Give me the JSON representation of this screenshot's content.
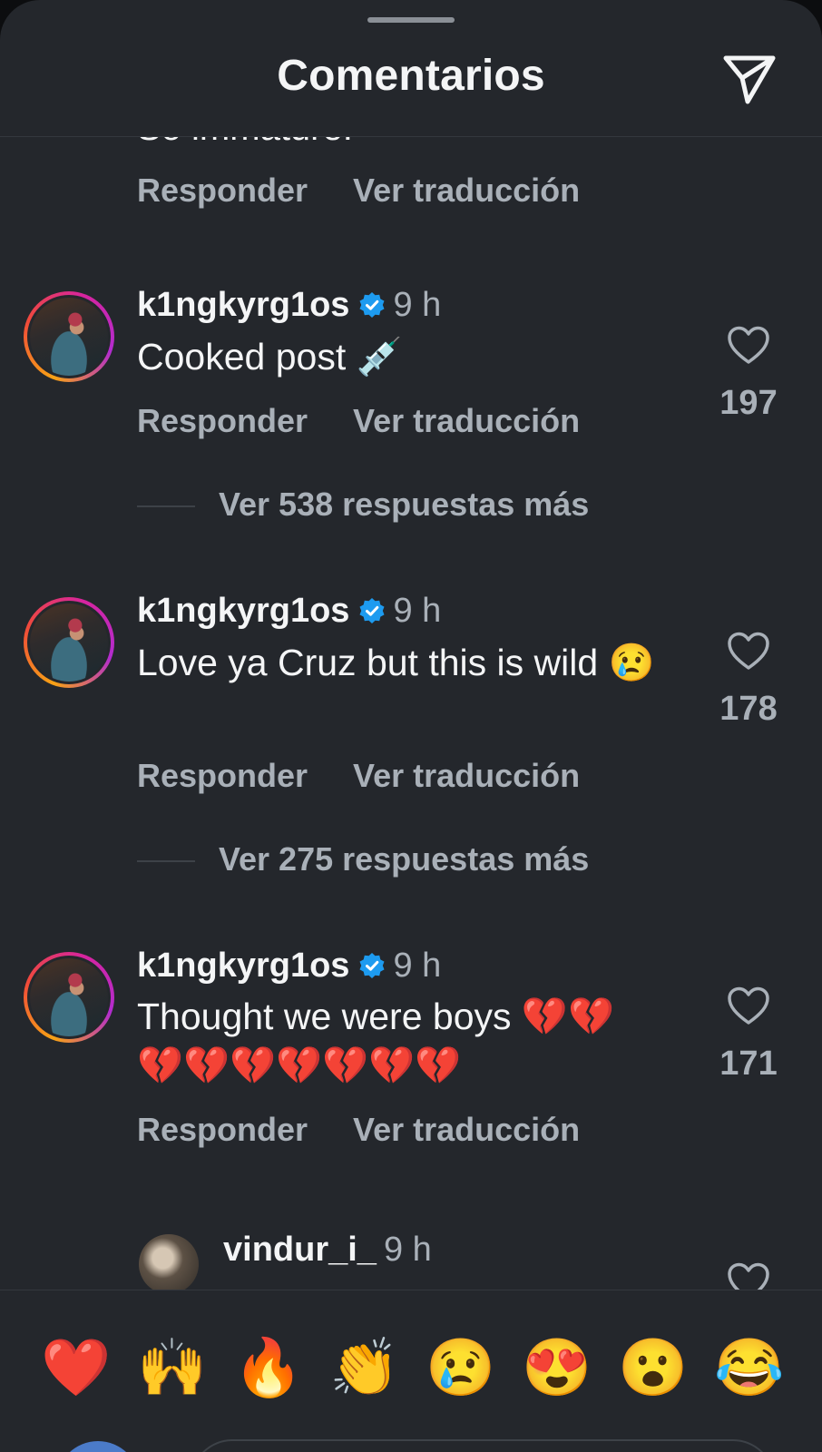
{
  "header": {
    "title": "Comentarios"
  },
  "truncated_comment": {
    "text_fragment": "So immature.",
    "reply_label": "Responder",
    "translate_label": "Ver traducción"
  },
  "comments": [
    {
      "username": "k1ngkyrg1os",
      "time": "9 h",
      "text": "Cooked post 💉",
      "likes": "197",
      "reply_label": "Responder",
      "translate_label": "Ver traducción",
      "more_replies": "Ver 538 respuestas más"
    },
    {
      "username": "k1ngkyrg1os",
      "time": "9 h",
      "text": "Love ya Cruz but this is wild 😢",
      "likes": "178",
      "reply_label": "Responder",
      "translate_label": "Ver traducción",
      "more_replies": "Ver 275 respuestas más"
    },
    {
      "username": "k1ngkyrg1os",
      "time": "9 h",
      "text": "Thought we were boys 💔💔💔💔💔💔💔💔💔",
      "likes": "171",
      "reply_label": "Responder",
      "translate_label": "Ver traducción"
    }
  ],
  "reply_preview": {
    "username": "vindur_i_",
    "time": "9 h"
  },
  "reactions": [
    "❤️",
    "🙌",
    "🔥",
    "👏",
    "😢",
    "😍",
    "😮",
    "😂"
  ],
  "colors": {
    "sheet_background": "#24272c",
    "secondary_text": "#a9b0b8",
    "verified_badge": "#1d9bf0"
  }
}
